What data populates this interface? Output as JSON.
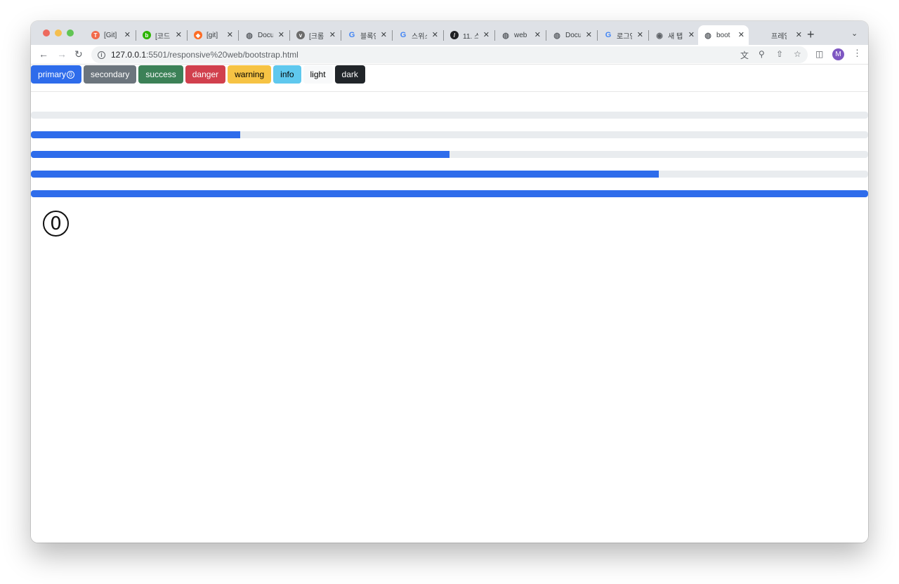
{
  "browser": {
    "tabs": [
      {
        "title": "[Git]",
        "icon": "tistory-icon",
        "color": "#f26a4b"
      },
      {
        "title": "[코드",
        "icon": "blog-icon",
        "color": "#2db400"
      },
      {
        "title": "[git]",
        "icon": "gitlab-icon",
        "color": "#fc6d26"
      },
      {
        "title": "Docu",
        "icon": "globe-icon",
        "color": "#5f6368"
      },
      {
        "title": "[크롬",
        "icon": "velog-icon",
        "color": "#6b6b6b"
      },
      {
        "title": "블록인",
        "icon": "google-icon",
        "color": "#4285f4"
      },
      {
        "title": "스위스",
        "icon": "google-icon",
        "color": "#4285f4"
      },
      {
        "title": "11. 스",
        "icon": "slash-icon",
        "color": "#202124"
      },
      {
        "title": "web",
        "icon": "globe-icon",
        "color": "#5f6368"
      },
      {
        "title": "Docu",
        "icon": "globe-icon",
        "color": "#5f6368"
      },
      {
        "title": "로그인",
        "icon": "google-icon",
        "color": "#4285f4"
      },
      {
        "title": "새 탭",
        "icon": "chrome-icon",
        "color": "#5f6368"
      },
      {
        "title": "boot",
        "icon": "globe-icon",
        "color": "#5f6368",
        "active": true
      },
      {
        "title": "프레임",
        "icon": "none",
        "color": "#5f6368"
      }
    ],
    "url_host": "127.0.0.1",
    "url_path": ":5501/responsive%20web/bootstrap.html",
    "avatar_letter": "M"
  },
  "buttons": [
    {
      "label": "primary",
      "badge": "0",
      "bg": "#2e6ceb",
      "fg": "#ffffff"
    },
    {
      "label": "secondary",
      "bg": "#6c757d",
      "fg": "#ffffff"
    },
    {
      "label": "success",
      "bg": "#3c8157",
      "fg": "#ffffff"
    },
    {
      "label": "danger",
      "bg": "#d1404d",
      "fg": "#ffffff"
    },
    {
      "label": "warning",
      "bg": "#f6c344",
      "fg": "#000000"
    },
    {
      "label": "info",
      "bg": "#5fc8ee",
      "fg": "#000000"
    },
    {
      "label": "light",
      "bg": "#f8f9fa",
      "fg": "#000000"
    },
    {
      "label": "dark",
      "bg": "#212529",
      "fg": "#ffffff"
    }
  ],
  "progress_bars": [
    0,
    25,
    50,
    75,
    100
  ],
  "circled_number": "⓪"
}
